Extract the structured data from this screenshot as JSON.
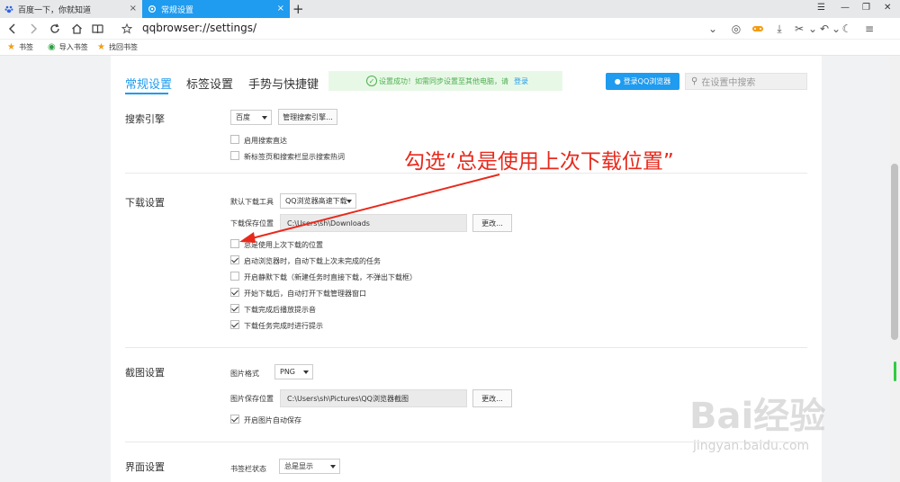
{
  "tabs": [
    {
      "title": "百度一下，你就知道"
    },
    {
      "title": "常规设置"
    }
  ],
  "address": {
    "url": "qqbrowser://settings/"
  },
  "bookmarks": [
    {
      "label": "书签"
    },
    {
      "label": "导入书签"
    },
    {
      "label": "找回书签"
    }
  ],
  "header": {
    "tabs": [
      {
        "label": "常规设置"
      },
      {
        "label": "标签设置"
      },
      {
        "label": "手势与快捷键"
      }
    ],
    "success_text": "设置成功！如需同步设置至其他电脑，请",
    "success_link": "登录",
    "login_label": "登录QQ浏览器",
    "search_placeholder": "在设置中搜索"
  },
  "search_engine": {
    "title": "搜索引擎",
    "engine": "百度",
    "manage_label": "管理搜索引擎...",
    "options": [
      {
        "label": "启用搜索直达",
        "checked": false
      },
      {
        "label": "新标签页和搜索栏显示搜索热词",
        "checked": false
      }
    ]
  },
  "download": {
    "title": "下载设置",
    "tool_label": "默认下载工具",
    "tool_value": "QQ浏览器高速下载",
    "path_label": "下载保存位置",
    "path_value": "C:\\Users\\sh\\Downloads",
    "change_label": "更改...",
    "options": [
      {
        "label": "总是使用上次下载的位置",
        "checked": false
      },
      {
        "label": "启动浏览器时，自动下载上次未完成的任务",
        "checked": true
      },
      {
        "label": "开启静默下载（新建任务时直接下载，不弹出下载框）",
        "checked": false
      },
      {
        "label": "开始下载后，自动打开下载管理器窗口",
        "checked": true
      },
      {
        "label": "下载完成后播放提示音",
        "checked": true
      },
      {
        "label": "下载任务完成时进行提示",
        "checked": true
      }
    ]
  },
  "screenshot": {
    "title": "截图设置",
    "format_label": "图片格式",
    "format_value": "PNG",
    "path_label": "图片保存位置",
    "path_value": "C:\\Users\\sh\\Pictures\\QQ浏览器截图",
    "change_label": "更改...",
    "options": [
      {
        "label": "开启图片自动保存",
        "checked": true
      }
    ]
  },
  "interface": {
    "title": "界面设置",
    "bookmark_bar_label": "书签栏状态",
    "bookmark_bar_value": "总是显示"
  },
  "annotation": {
    "text": "勾选“总是使用上次下载位置”",
    "color": "#e8291c"
  },
  "watermark": {
    "main": "Bai经验",
    "sub": "jingyan.baidu.com"
  },
  "colors": {
    "accent": "#1f9bef",
    "success_bg": "#e8f8e6",
    "success": "#4caf50"
  }
}
